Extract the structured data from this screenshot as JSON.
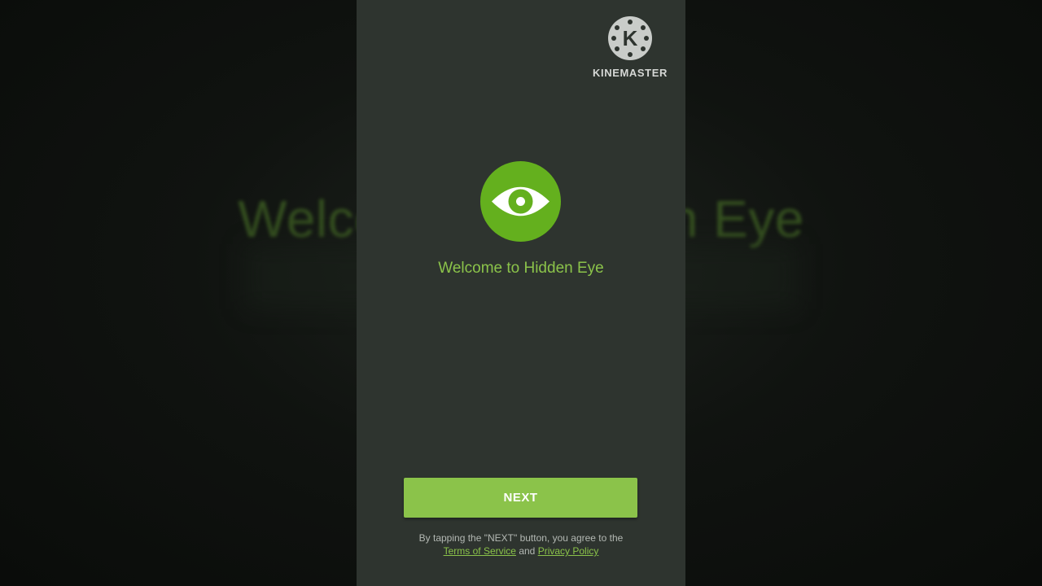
{
  "background": {
    "blurred_text": "Welcome to Hidden Eye"
  },
  "watermark": {
    "letter": "K",
    "label": "KINEMASTER"
  },
  "app": {
    "logo_icon": "eye-icon",
    "welcome_text": "Welcome to Hidden Eye"
  },
  "actions": {
    "next_label": "NEXT"
  },
  "legal": {
    "line1": "By tapping the \"NEXT\" button, you agree to the",
    "terms_link": "Terms of Service",
    "and_text": "and",
    "privacy_link": "Privacy Policy"
  },
  "colors": {
    "accent": "#8bc34a",
    "logo_green": "#64b01e",
    "screen_bg": "#2e342f",
    "letterbox_bg": "#0c0e0c"
  }
}
